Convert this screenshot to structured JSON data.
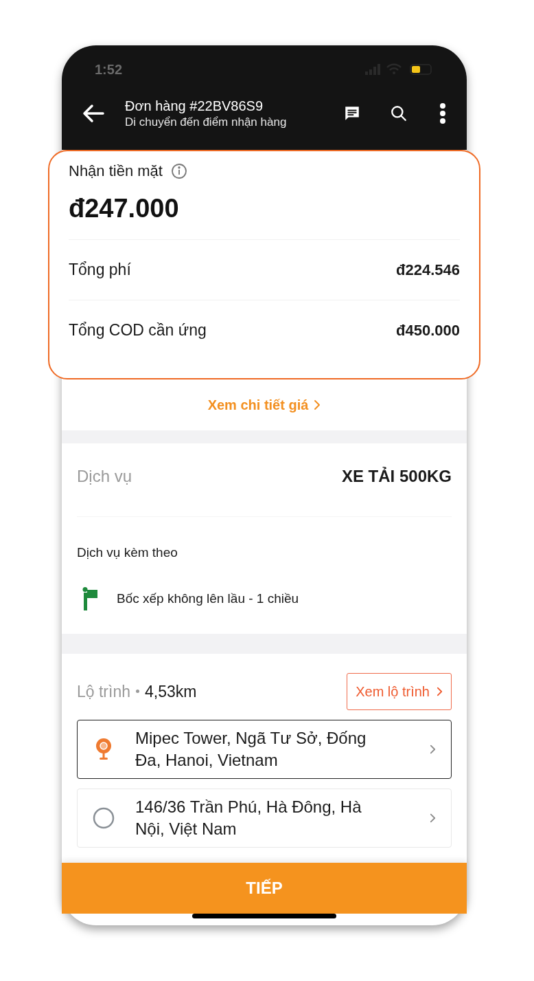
{
  "status_bar": {
    "time": "1:52"
  },
  "header": {
    "title": "Đơn hàng #22BV86S9",
    "subtitle": "Di chuyển đến điểm nhận hàng"
  },
  "payment": {
    "label": "Nhận tiền mặt",
    "amount": "đ247.000",
    "highlighted": true,
    "rows": [
      {
        "label": "Tổng phí",
        "value": "đ224.546"
      },
      {
        "label": "Tổng COD cần ứng",
        "value": "đ450.000"
      }
    ]
  },
  "price_link": "Xem chi tiết giá",
  "service": {
    "label": "Dịch vụ",
    "value": "XE TẢI 500KG",
    "extras_title": "Dịch vụ kèm theo",
    "extras": [
      {
        "label": "Bốc xếp không lên lầu - 1 chiều"
      }
    ]
  },
  "route": {
    "label": "Lộ trình",
    "distance": "4,53km",
    "button": "Xem lộ trình",
    "stops": [
      {
        "kind": "pickup",
        "address": "Mipec Tower, Ngã Tư Sở, Đống Đa, Hanoi, Vietnam",
        "selected": true
      },
      {
        "kind": "dropoff",
        "address": "146/36 Trần Phú, Hà Đông, Hà Nội, Việt Nam",
        "selected": false
      }
    ]
  },
  "primary_button": "TIẾP"
}
